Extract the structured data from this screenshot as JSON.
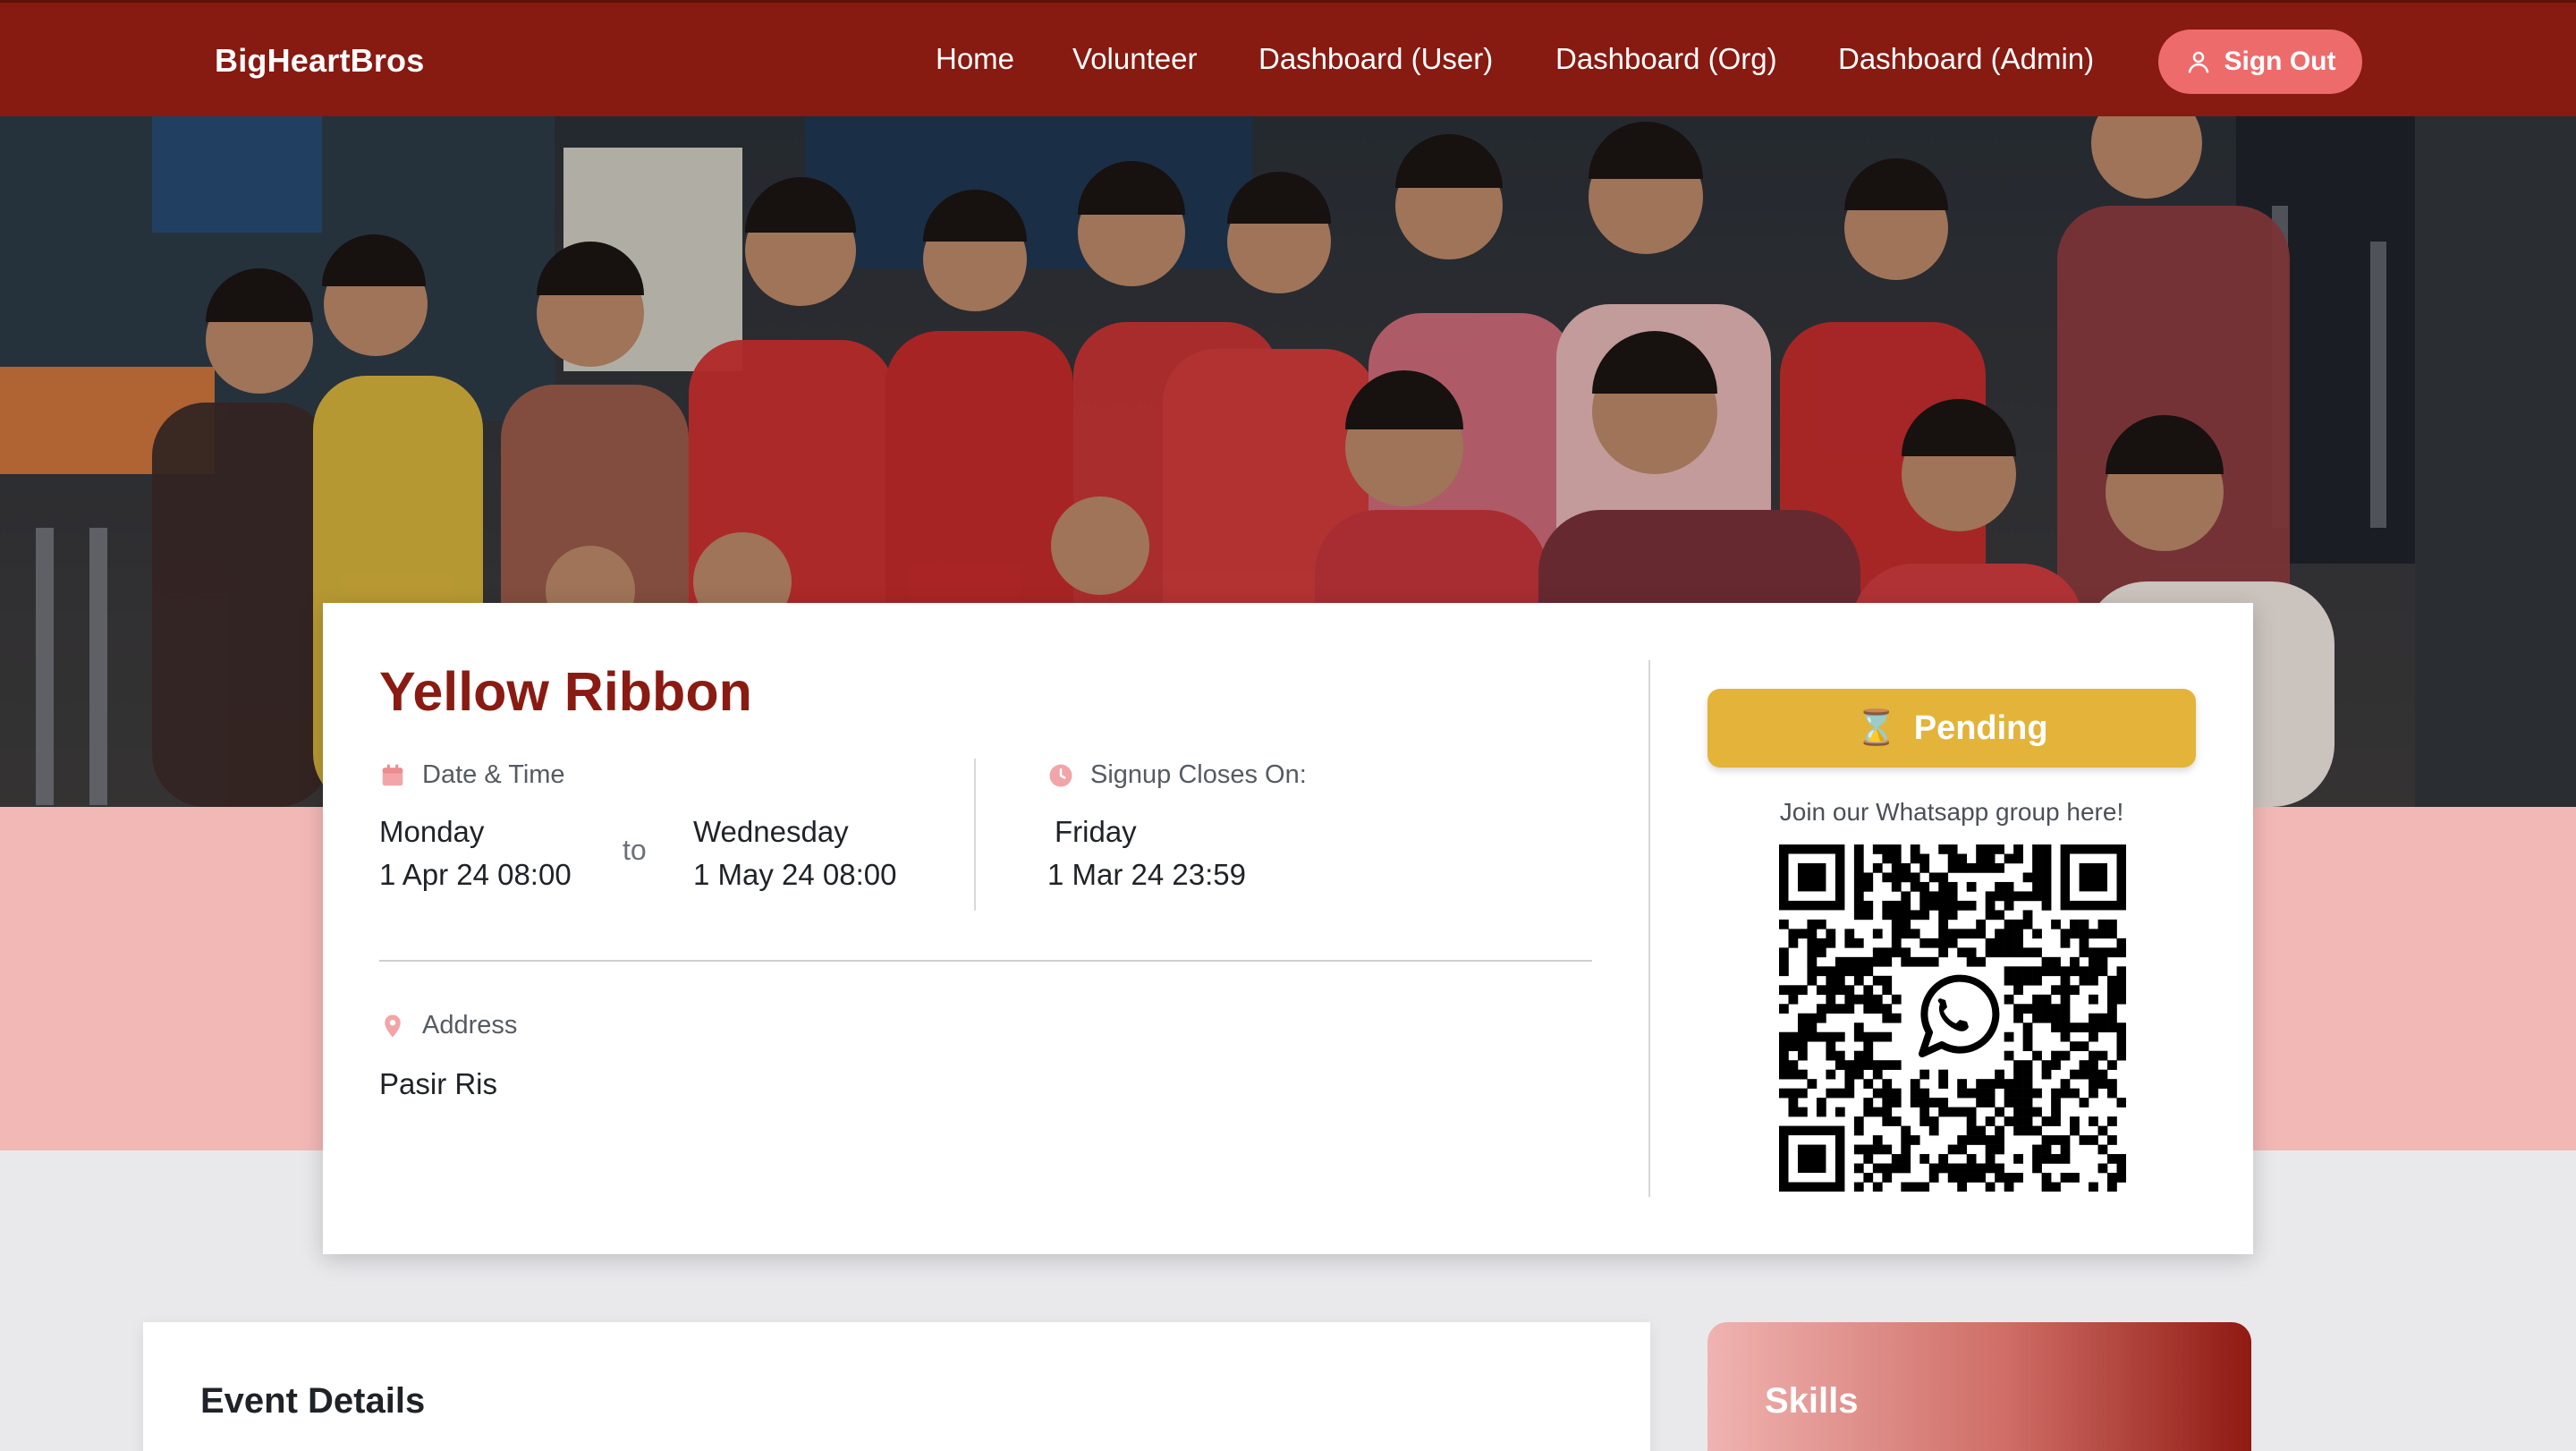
{
  "navbar": {
    "brand": "BigHeartBros",
    "links": [
      "Home",
      "Volunteer",
      "Dashboard (User)",
      "Dashboard (Org)",
      "Dashboard (Admin)"
    ],
    "signout_label": "Sign Out",
    "background_color": "#871a11",
    "signout_color": "#ee6b6b"
  },
  "event": {
    "title": "Yellow Ribbon",
    "date_time_label": "Date & Time",
    "start_day": "Monday",
    "start_datetime": "1 Apr 24 08:00",
    "to_word": "to",
    "end_day": "Wednesday",
    "end_datetime": "1 May 24 08:00",
    "signup_label": "Signup Closes On:",
    "signup_day": "Friday",
    "signup_datetime": "1 Mar 24 23:59",
    "address_label": "Address",
    "address": "Pasir Ris",
    "status_icon": "⌛",
    "status_label": "Pending",
    "status_color": "#e3b33a",
    "whatsapp_text": "Join our Whatsapp group here!"
  },
  "sections": {
    "details_title": "Event Details",
    "skills_title": "Skills"
  },
  "colors": {
    "accent": "#8a1b12",
    "pink_band": "#f2b8b6",
    "icon_pink": "#f2a5a8"
  }
}
